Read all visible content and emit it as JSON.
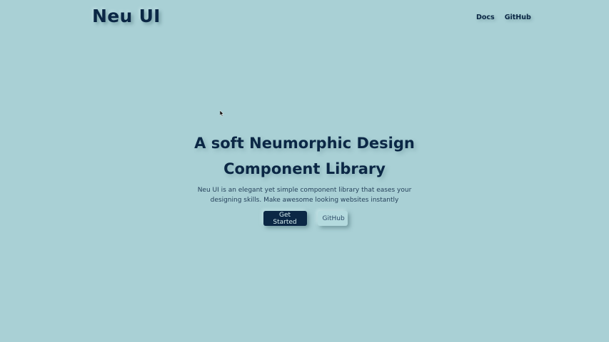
{
  "header": {
    "logo": "Neu UI",
    "nav": [
      {
        "label": "Docs"
      },
      {
        "label": "GitHub"
      }
    ]
  },
  "hero": {
    "headline_line1": "A soft Neumorphic Design",
    "headline_line2": "Component Library",
    "description": "Neu UI is an elegant yet simple component library that eases your designing skills. Make awesome looking websites instantly",
    "primary_button": "Get Started",
    "secondary_button": "GitHub"
  },
  "colors": {
    "background": "#a9d0d5",
    "text_dark": "#0b2745",
    "primary_button_bg": "#0b2745",
    "secondary_button_bg": "#b4dade"
  }
}
